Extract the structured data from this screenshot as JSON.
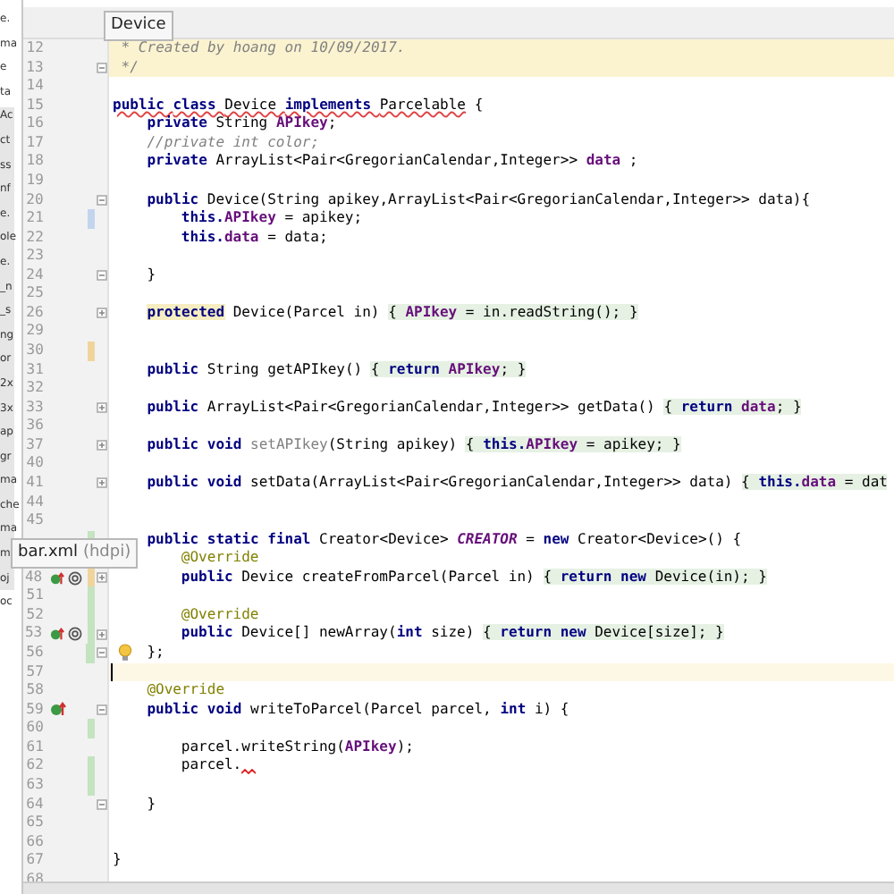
{
  "project_tree": [
    {
      "text": "e."
    },
    {
      "text": "ma"
    },
    {
      "text": "e"
    },
    {
      "text": "ta"
    },
    {
      "text": "Ac"
    },
    {
      "text": "ct"
    },
    {
      "text": "ss"
    },
    {
      "text": "nf"
    },
    {
      "text": "e."
    },
    {
      "text": "ole"
    },
    {
      "text": "e."
    },
    {
      "text": "_n"
    },
    {
      "text": "_s"
    },
    {
      "text": "ng"
    },
    {
      "text": "or"
    },
    {
      "text": "2x"
    },
    {
      "text": "3x"
    },
    {
      "text": "ap"
    },
    {
      "text": "gr"
    },
    {
      "text": "ma"
    },
    {
      "text": "che"
    },
    {
      "text": "ma"
    },
    {
      "text": "m"
    },
    {
      "text": "oj"
    },
    {
      "text": "oc"
    }
  ],
  "tooltips": [
    {
      "kind": "symbol",
      "text": "Device"
    },
    {
      "kind": "file",
      "text": "bar.xml",
      "note": "(hdpi)"
    }
  ],
  "lines": [
    {
      "number": "12",
      "highlighted": true,
      "kind": "comment",
      "tokens": [
        {
          "text": "* Created by hoang on 10/09/2017.",
          "kind": "comment"
        }
      ]
    },
    {
      "number": "13",
      "highlighted": true,
      "fold_end": true,
      "kind": "comment",
      "tokens": [
        {
          "text": "*/",
          "kind": "comment"
        }
      ]
    },
    {
      "number": "14"
    },
    {
      "number": "15",
      "kind": "top",
      "tokens": [
        {
          "kind": "warning",
          "parts": [
            {
              "text": "public ",
              "kind": "keyword"
            },
            {
              "text": "class ",
              "kind": "keyword"
            },
            {
              "text": "Device "
            },
            {
              "text": "implements ",
              "kind": "keyword"
            },
            {
              "text": "Parcelable"
            }
          ]
        },
        {
          "text": " {"
        }
      ]
    },
    {
      "number": "16",
      "kind": "member",
      "tokens": [
        {
          "text": "private ",
          "kind": "keyword"
        },
        {
          "text": "String "
        },
        {
          "text": "APIkey",
          "kind": "field"
        },
        {
          "text": ";"
        }
      ]
    },
    {
      "number": "17",
      "kind": "member",
      "tokens": [
        {
          "text": "//private int color;",
          "kind": "comment"
        }
      ]
    },
    {
      "number": "18",
      "kind": "member",
      "tokens": [
        {
          "text": "private ",
          "kind": "keyword"
        },
        {
          "text": "ArrayList<Pair<GregorianCalendar,Integer>> "
        },
        {
          "text": "data",
          "kind": "field"
        },
        {
          "text": " ;"
        }
      ]
    },
    {
      "number": "19"
    },
    {
      "number": "20",
      "fold_start": true,
      "kind": "member",
      "tokens": [
        {
          "text": "public ",
          "kind": "keyword"
        },
        {
          "text": "Device(String apikey,ArrayList<Pair<GregorianCalendar,Integer>> data){"
        }
      ]
    },
    {
      "number": "21",
      "marker": {
        "color": "#c2d4ee"
      },
      "kind": "body",
      "tokens": [
        {
          "text": "this.",
          "kind": "keyword"
        },
        {
          "text": "APIkey",
          "kind": "field"
        },
        {
          "text": " = apikey;"
        }
      ]
    },
    {
      "number": "22",
      "kind": "body",
      "tokens": [
        {
          "text": "this.",
          "kind": "keyword"
        },
        {
          "text": "data",
          "kind": "field"
        },
        {
          "text": " = data;"
        }
      ]
    },
    {
      "number": "23"
    },
    {
      "number": "24",
      "fold_end": true,
      "kind": "member",
      "tokens": [
        {
          "text": "}"
        }
      ]
    },
    {
      "number": "25"
    },
    {
      "number": "26",
      "collapsed": true,
      "kind": "member",
      "tokens": [
        {
          "text": "protected",
          "kind": "keyword-marked"
        },
        {
          "text": " Device(Parcel in) "
        },
        {
          "kind": "folded",
          "parts": [
            {
              "text": "{ "
            },
            {
              "text": "APIkey",
              "kind": "field"
            },
            {
              "text": " = in.readString(); }"
            }
          ]
        }
      ]
    },
    {
      "number": "29"
    },
    {
      "number": "30",
      "marker": {
        "color": "#f0d49c"
      }
    },
    {
      "number": "31",
      "kind": "member",
      "tokens": [
        {
          "text": "public ",
          "kind": "keyword"
        },
        {
          "text": "String getAPIkey() "
        },
        {
          "kind": "folded",
          "parts": [
            {
              "text": "{ "
            },
            {
              "text": "return ",
              "kind": "keyword"
            },
            {
              "text": "APIkey",
              "kind": "field"
            },
            {
              "text": "; }"
            }
          ]
        }
      ]
    },
    {
      "number": "32"
    },
    {
      "number": "33",
      "collapsed": true,
      "kind": "member",
      "tokens": [
        {
          "text": "public ",
          "kind": "keyword"
        },
        {
          "text": "ArrayList<Pair<GregorianCalendar,Integer>> getData() "
        },
        {
          "kind": "folded",
          "parts": [
            {
              "text": "{ "
            },
            {
              "text": "return ",
              "kind": "keyword"
            },
            {
              "text": "data",
              "kind": "field"
            },
            {
              "text": "; }"
            }
          ]
        }
      ]
    },
    {
      "number": "36"
    },
    {
      "number": "37",
      "collapsed": true,
      "kind": "member",
      "tokens": [
        {
          "text": "public ",
          "kind": "keyword"
        },
        {
          "text": "void ",
          "kind": "keyword"
        },
        {
          "text": "setAPIkey",
          "kind": "unused"
        },
        {
          "text": "(String apikey) "
        },
        {
          "kind": "folded",
          "parts": [
            {
              "text": "{ "
            },
            {
              "text": "this.",
              "kind": "keyword"
            },
            {
              "text": "APIkey",
              "kind": "field"
            },
            {
              "text": " = apikey; }"
            }
          ]
        }
      ]
    },
    {
      "number": "40"
    },
    {
      "number": "41",
      "collapsed": true,
      "kind": "member",
      "tokens": [
        {
          "text": "public ",
          "kind": "keyword"
        },
        {
          "text": "void ",
          "kind": "keyword"
        },
        {
          "text": "setData(ArrayList<Pair<GregorianCalendar,Integer>> data) "
        },
        {
          "kind": "folded",
          "parts": [
            {
              "text": "{ "
            },
            {
              "text": "this.",
              "kind": "keyword"
            },
            {
              "text": "data",
              "kind": "field"
            },
            {
              "text": " = dat"
            }
          ]
        }
      ]
    },
    {
      "number": "44"
    },
    {
      "number": "45"
    },
    {
      "marker": {
        "color": "#c4e3c0"
      },
      "kind": "member",
      "tokens": [
        {
          "text": "public ",
          "kind": "keyword"
        },
        {
          "text": "static ",
          "kind": "keyword"
        },
        {
          "text": "final ",
          "kind": "keyword"
        },
        {
          "text": "Creator<Device> "
        },
        {
          "text": "CREATOR",
          "kind": "constant"
        },
        {
          "text": " = "
        },
        {
          "text": "new ",
          "kind": "keyword"
        },
        {
          "text": "Creator<Device>() {"
        }
      ]
    },
    {
      "kind": "body",
      "tokens": [
        {
          "text": "@Override",
          "kind": "annotation"
        }
      ]
    },
    {
      "number": "48",
      "marker": {
        "color": "#f0d49c"
      },
      "collapsed": true,
      "gutter_icons": [
        {
          "kind": "override"
        },
        {
          "kind": "at"
        }
      ],
      "kind": "body",
      "tokens": [
        {
          "text": "public ",
          "kind": "keyword"
        },
        {
          "text": "Device createFromParcel(Parcel in) "
        },
        {
          "kind": "folded",
          "parts": [
            {
              "text": "{ "
            },
            {
              "text": "return ",
              "kind": "keyword"
            },
            {
              "text": "new ",
              "kind": "keyword"
            },
            {
              "text": "Device(in); }"
            }
          ]
        }
      ]
    },
    {
      "number": "51",
      "marker": {
        "color": "#c4e3c0"
      }
    },
    {
      "number": "52",
      "marker": {
        "color": "#c4e3c0"
      },
      "kind": "body",
      "tokens": [
        {
          "text": "@Override",
          "kind": "annotation"
        }
      ]
    },
    {
      "number": "53",
      "marker": {
        "color": "#c4e3c0"
      },
      "collapsed": true,
      "gutter_icons": [
        {
          "kind": "override"
        },
        {
          "kind": "at"
        }
      ],
      "kind": "body",
      "tokens": [
        {
          "text": "public ",
          "kind": "keyword"
        },
        {
          "text": "Device[] newArray("
        },
        {
          "text": "int ",
          "kind": "keyword"
        },
        {
          "text": "size) "
        },
        {
          "kind": "folded",
          "parts": [
            {
              "text": "{ "
            },
            {
              "text": "return ",
              "kind": "keyword"
            },
            {
              "text": "new ",
              "kind": "keyword"
            },
            {
              "text": "Device[size]; }"
            }
          ]
        }
      ]
    },
    {
      "number": "56",
      "marker": {
        "color": "#c4e3c0"
      },
      "fold_end": true,
      "bulb": true,
      "kind": "member",
      "tokens": [
        {
          "text": "};"
        }
      ]
    },
    {
      "number": "57",
      "current": true
    },
    {
      "number": "58",
      "kind": "member",
      "tokens": [
        {
          "text": "@Override",
          "kind": "annotation"
        }
      ]
    },
    {
      "number": "59",
      "fold_start": true,
      "gutter_icons": [
        {
          "kind": "override"
        }
      ],
      "kind": "member",
      "tokens": [
        {
          "text": "public ",
          "kind": "keyword"
        },
        {
          "text": "void ",
          "kind": "keyword"
        },
        {
          "text": "writeToParcel(Parcel parcel, "
        },
        {
          "text": "int ",
          "kind": "keyword"
        },
        {
          "text": "i) {"
        }
      ]
    },
    {
      "number": "60",
      "marker": {
        "color": "#c4e3c0"
      }
    },
    {
      "number": "61",
      "kind": "body",
      "tokens": [
        {
          "text": "parcel.writeString("
        },
        {
          "text": "APIkey",
          "kind": "field"
        },
        {
          "text": ");"
        }
      ]
    },
    {
      "number": "62",
      "marker": {
        "color": "#c4e3c0"
      },
      "squiggle": true,
      "kind": "body",
      "tokens": [
        {
          "text": "parcel."
        }
      ]
    },
    {
      "number": "63",
      "marker": {
        "color": "#c4e3c0"
      }
    },
    {
      "number": "64",
      "fold_end": true,
      "kind": "member",
      "tokens": [
        {
          "text": "}"
        }
      ]
    },
    {
      "number": "65"
    },
    {
      "number": "66"
    },
    {
      "number": "67",
      "kind": "top",
      "tokens": [
        {
          "text": "}"
        }
      ]
    },
    {
      "number": "68"
    }
  ]
}
